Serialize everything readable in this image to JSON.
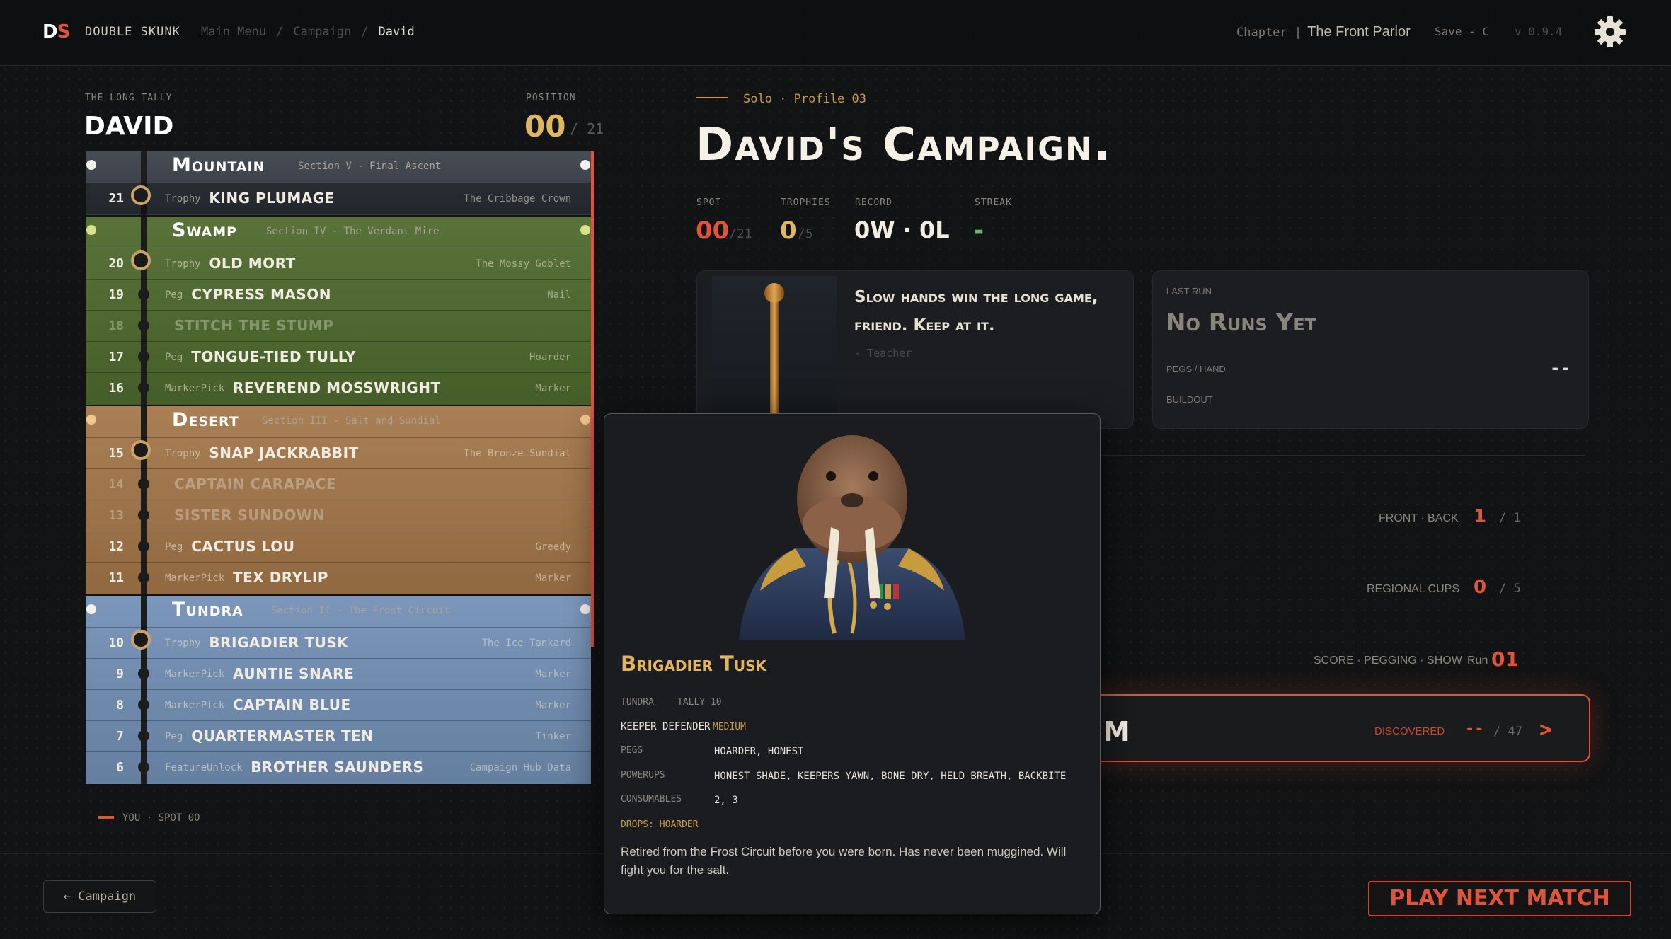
{
  "header": {
    "logo_d": "D",
    "logo_s": "S",
    "brand": "DOUBLE SKUNK",
    "breadcrumbs": [
      "Main Menu",
      "Campaign",
      "David"
    ],
    "chapter_label": "Chapter |",
    "chapter_value": "The Front Parlor",
    "save": "Save - C",
    "version": "v 0.9.4"
  },
  "left": {
    "section_label": "THE LONG TALLY",
    "player_name": "DAVID",
    "position_label": "POSITION",
    "position_value": "00",
    "position_total": "/ 21",
    "you_marker": "YOU · SPOT 00",
    "regions": [
      {
        "name": "Mountain",
        "subtitle": "Section V - Final Ascent",
        "color": "#3b414a",
        "rows": [
          {
            "num": "21",
            "type": "Trophy",
            "title": "KING PLUMAGE",
            "reward": "The Cribbage Crown",
            "trophy": true
          }
        ]
      },
      {
        "name": "Swamp",
        "subtitle": "Section IV - The Verdant Mire",
        "color": "#4f6a2e",
        "rows": [
          {
            "num": "20",
            "type": "Trophy",
            "title": "OLD MORT",
            "reward": "The Mossy Goblet",
            "trophy": true
          },
          {
            "num": "19",
            "type": "Peg",
            "title": "CYPRESS MASON",
            "reward": "Nail"
          },
          {
            "num": "18",
            "type": "",
            "title": "STITCH THE STUMP",
            "reward": "",
            "dim": true
          },
          {
            "num": "17",
            "type": "Peg",
            "title": "TONGUE-TIED TULLY",
            "reward": "Hoarder"
          },
          {
            "num": "16",
            "type": "MarkerPick",
            "title": "REVEREND MOSSWRIGHT",
            "reward": "Marker"
          }
        ]
      },
      {
        "name": "Desert",
        "subtitle": "Section III - Salt and Sundial",
        "color": "#a4774a",
        "rows": [
          {
            "num": "15",
            "type": "Trophy",
            "title": "SNAP JACKRABBIT",
            "reward": "The Bronze Sundial",
            "trophy": true
          },
          {
            "num": "14",
            "type": "",
            "title": "CAPTAIN CARAPACE",
            "reward": "",
            "dim": true
          },
          {
            "num": "13",
            "type": "",
            "title": "SISTER SUNDOWN",
            "reward": "",
            "dim": true
          },
          {
            "num": "12",
            "type": "Peg",
            "title": "CACTUS LOU",
            "reward": "Greedy"
          },
          {
            "num": "11",
            "type": "MarkerPick",
            "title": "TEX DRYLIP",
            "reward": "Marker"
          }
        ]
      },
      {
        "name": "Tundra",
        "subtitle": "Section II - The Frost Circuit",
        "color": "#7390b6",
        "rows": [
          {
            "num": "10",
            "type": "Trophy",
            "title": "BRIGADIER TUSK",
            "reward": "The Ice Tankard",
            "trophy": true
          },
          {
            "num": "9",
            "type": "MarkerPick",
            "title": "AUNTIE SNARE",
            "reward": "Marker"
          },
          {
            "num": "8",
            "type": "MarkerPick",
            "title": "CAPTAIN BLUE",
            "reward": "Marker"
          },
          {
            "num": "7",
            "type": "Peg",
            "title": "QUARTERMASTER TEN",
            "reward": "Tinker"
          },
          {
            "num": "6",
            "type": "FeatureUnlock",
            "title": "BROTHER SAUNDERS",
            "reward": "Campaign Hub Data"
          }
        ]
      }
    ]
  },
  "main": {
    "mode": "Solo · Profile 03",
    "title": "David's Campaign.",
    "stats": {
      "spot_label": "SPOT",
      "spot_value": "00",
      "spot_total": "/21",
      "trophies_label": "TROPHIES",
      "trophies_value": "0",
      "trophies_total": "/5",
      "record_label": "RECORD",
      "record_value": "0W · 0L",
      "streak_label": "STREAK",
      "streak_value": "-"
    },
    "teacher": {
      "quote": "Slow hands win the long game, friend. Keep at it.",
      "by": "- Teacher"
    },
    "last_run": {
      "label": "LAST RUN",
      "value": "No Runs Yet",
      "pegs_label": "PEGS / HAND",
      "pegs_value": "--",
      "buildout_label": "BUILDOUT"
    },
    "front_back": {
      "label": "FRONT · BACK",
      "value": "1",
      "total": "/ 1"
    },
    "regional_cups": {
      "label": "REGIONAL CUPS",
      "value": "0",
      "total": "/ 5"
    },
    "score_run": {
      "label": "SCORE · PEGGING · SHOW",
      "run_label": "Run",
      "run_value": "01"
    },
    "museum": {
      "title": "UM",
      "discovered_label": "DISCOVERED",
      "discovered_value": "--",
      "discovered_total": "/ 47",
      "arrow": ">"
    }
  },
  "popup": {
    "name": "Brigadier Tusk",
    "region": "TUNDRA",
    "tally": "TALLY 10",
    "role": "KEEPER DEFENDER",
    "difficulty": "MEDIUM",
    "pegs_label": "PEGS",
    "pegs_value": "HOARDER, HONEST",
    "powerups_label": "POWERUPS",
    "powerups_value": "HONEST SHADE, KEEPERS YAWN, BONE DRY, HELD BREATH, BACKBITE",
    "consumables_label": "CONSUMABLES",
    "consumables_value": "2, 3",
    "drops": "DROPS: HOARDER",
    "description": "Retired from the Frost Circuit before you were born. Has never been muggined. Will fight you for the salt."
  },
  "footer": {
    "back_label": "← Campaign",
    "play_label": "PLAY NEXT MATCH"
  },
  "colors": {
    "accent": "#e0553a",
    "gold": "#e0b65e",
    "background": "#121314"
  }
}
